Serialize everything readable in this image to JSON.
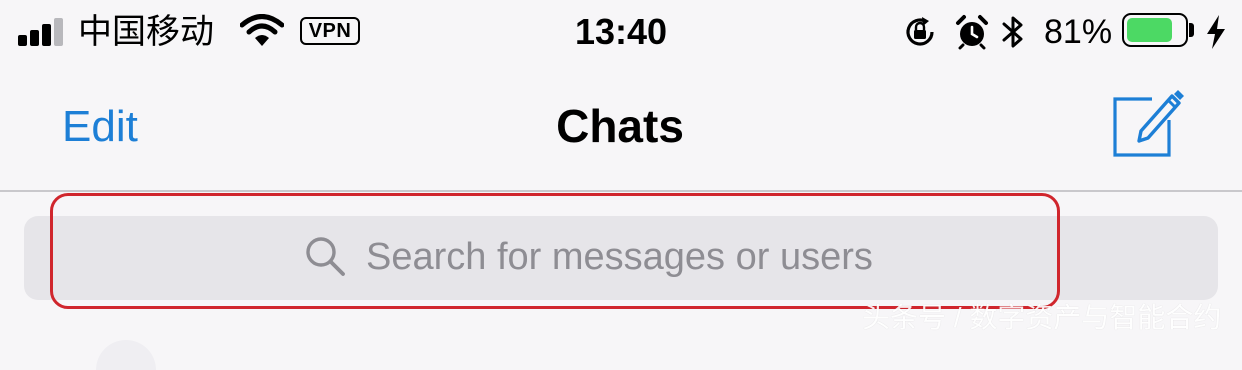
{
  "status_bar": {
    "carrier": "中国移动",
    "vpn_label": "VPN",
    "time": "13:40",
    "battery_percent_text": "81%",
    "battery_level": 0.81,
    "icons": [
      "signal-icon",
      "wifi-icon",
      "orientation-lock-icon",
      "alarm-icon",
      "bluetooth-icon",
      "battery-icon",
      "charging-icon"
    ]
  },
  "nav": {
    "edit_label": "Edit",
    "title": "Chats",
    "compose_icon": "compose-icon"
  },
  "search": {
    "placeholder": "Search for messages or users",
    "value": "",
    "icon": "search-icon"
  },
  "colors": {
    "accent": "#1d7fd6",
    "battery": "#4cd964",
    "highlight": "#d0262d",
    "background": "#f7f6f8",
    "search_background": "#e6e5e9"
  },
  "watermark": "头条号 / 数字资产与智能合约"
}
